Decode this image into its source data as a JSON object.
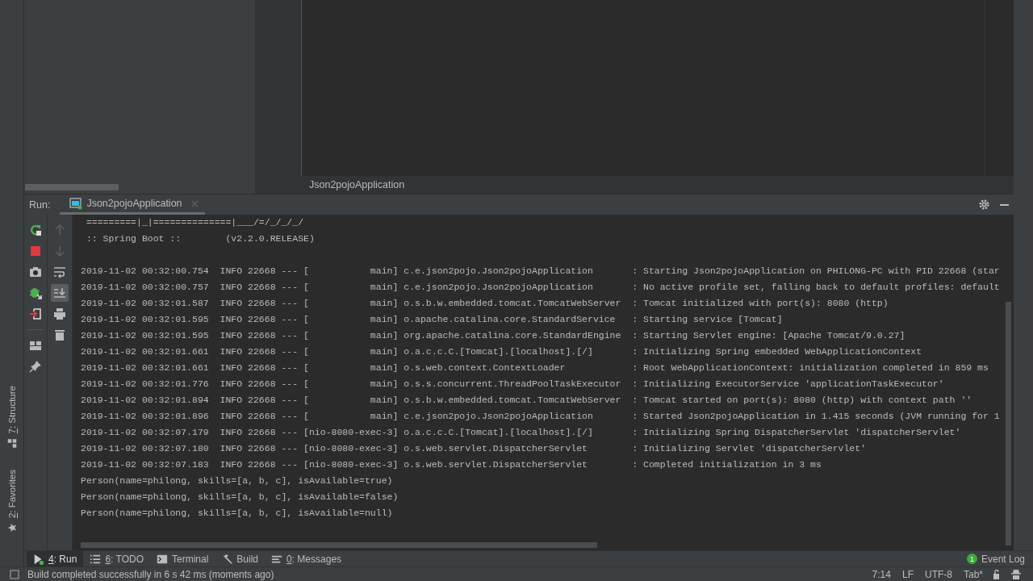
{
  "editor": {
    "breadcrumb": "Json2pojoApplication"
  },
  "side_stripe": [
    {
      "kind": "structure",
      "mnemonic": "7",
      "label": ": Structure"
    },
    {
      "kind": "favorites",
      "mnemonic": "2",
      "label": ": Favorites"
    }
  ],
  "run_panel": {
    "label": "Run:",
    "tabs": [
      {
        "title": "Json2pojoApplication",
        "selected": true
      }
    ],
    "toolbar_1": [
      {
        "kind": "rerun"
      },
      {
        "kind": "stop"
      },
      {
        "kind": "camera"
      },
      {
        "kind": "debug"
      },
      {
        "kind": "exit"
      },
      {
        "kind": "layout"
      },
      {
        "kind": "pin"
      }
    ],
    "toolbar_2": [
      {
        "kind": "up",
        "disabled": true,
        "on": false
      },
      {
        "kind": "down",
        "disabled": true,
        "on": false
      },
      {
        "kind": "wrap",
        "disabled": false,
        "on": false
      },
      {
        "kind": "scroll-end",
        "disabled": false,
        "on": true
      },
      {
        "kind": "print",
        "disabled": false,
        "on": false
      },
      {
        "kind": "trash",
        "disabled": false,
        "on": false
      }
    ],
    "banner": [
      " =========|_|==============|___/=/_/_/_/",
      " :: Spring Boot ::        (v2.2.0.RELEASE)"
    ],
    "log_lines": [
      "2019-11-02 00:32:00.754  INFO 22668 --- [           main] c.e.json2pojo.Json2pojoApplication       : Starting Json2pojoApplication on PHILONG-PC with PID 22668 (star",
      "2019-11-02 00:32:00.757  INFO 22668 --- [           main] c.e.json2pojo.Json2pojoApplication       : No active profile set, falling back to default profiles: default",
      "2019-11-02 00:32:01.587  INFO 22668 --- [           main] o.s.b.w.embedded.tomcat.TomcatWebServer  : Tomcat initialized with port(s): 8080 (http)",
      "2019-11-02 00:32:01.595  INFO 22668 --- [           main] o.apache.catalina.core.StandardService   : Starting service [Tomcat]",
      "2019-11-02 00:32:01.595  INFO 22668 --- [           main] org.apache.catalina.core.StandardEngine  : Starting Servlet engine: [Apache Tomcat/9.0.27]",
      "2019-11-02 00:32:01.661  INFO 22668 --- [           main] o.a.c.c.C.[Tomcat].[localhost].[/]       : Initializing Spring embedded WebApplicationContext",
      "2019-11-02 00:32:01.661  INFO 22668 --- [           main] o.s.web.context.ContextLoader            : Root WebApplicationContext: initialization completed in 859 ms",
      "2019-11-02 00:32:01.776  INFO 22668 --- [           main] o.s.s.concurrent.ThreadPoolTaskExecutor  : Initializing ExecutorService 'applicationTaskExecutor'",
      "2019-11-02 00:32:01.894  INFO 22668 --- [           main] o.s.b.w.embedded.tomcat.TomcatWebServer  : Tomcat started on port(s): 8080 (http) with context path ''",
      "2019-11-02 00:32:01.896  INFO 22668 --- [           main] c.e.json2pojo.Json2pojoApplication       : Started Json2pojoApplication in 1.415 seconds (JVM running for 1",
      "2019-11-02 00:32:07.179  INFO 22668 --- [nio-8080-exec-3] o.a.c.c.C.[Tomcat].[localhost].[/]       : Initializing Spring DispatcherServlet 'dispatcherServlet'",
      "2019-11-02 00:32:07.180  INFO 22668 --- [nio-8080-exec-3] o.s.web.servlet.DispatcherServlet        : Initializing Servlet 'dispatcherServlet'",
      "2019-11-02 00:32:07.183  INFO 22668 --- [nio-8080-exec-3] o.s.web.servlet.DispatcherServlet        : Completed initialization in 3 ms"
    ],
    "output_lines": [
      "Person(name=philong, skills=[a, b, c], isAvailable=true)",
      "Person(name=philong, skills=[a, b, c], isAvailable=false)",
      "Person(name=philong, skills=[a, b, c], isAvailable=null)"
    ]
  },
  "tool_windows": [
    {
      "kind": "run",
      "mnemonic": "4",
      "label": ": Run",
      "selected": true
    },
    {
      "kind": "todo",
      "mnemonic": "6",
      "label": ": TODO",
      "selected": false
    },
    {
      "kind": "terminal",
      "label": "Terminal",
      "selected": false
    },
    {
      "kind": "build",
      "label": "Build",
      "selected": false
    },
    {
      "kind": "messages",
      "mnemonic": "0",
      "label": ": Messages",
      "selected": false
    }
  ],
  "event_log": {
    "label": "Event Log",
    "badge": "1"
  },
  "status_bar": {
    "message": "Build completed successfully in 6 s 42 ms (moments ago)",
    "position": "7:14",
    "line_separator": "LF",
    "encoding": "UTF-8",
    "indent": "Tab*"
  }
}
